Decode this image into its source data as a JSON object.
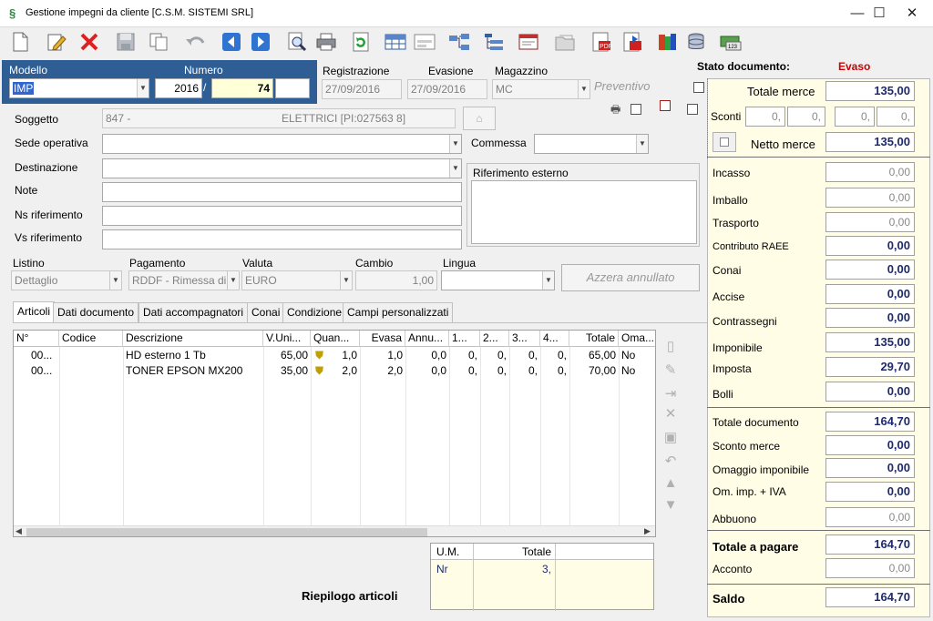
{
  "window": {
    "title": "Gestione impegni da cliente [C.S.M. SISTEMI SRL]",
    "minimize": "—",
    "maximize": "☐",
    "close": "✕"
  },
  "toolbar": {
    "icons": [
      "new-document-icon",
      "edit-icon",
      "delete-icon",
      "save-icon",
      "copy-icon",
      "undo-icon",
      "previous-record-icon",
      "next-record-icon",
      "search-icon",
      "print-icon",
      "refresh-icon",
      "table-icon",
      "form-view-icon",
      "transfer-icon",
      "tree-list-icon",
      "email-icon",
      "folder-icon",
      "pdf-icon",
      "pdf-send-icon",
      "books-icon",
      "database-icon",
      "money-icon"
    ]
  },
  "header": {
    "modello_label": "Modello",
    "modello_value": "IMP",
    "numero_label": "Numero",
    "numero_year": "2016",
    "numero_sep": "/",
    "numero_value": "74",
    "registrazione_label": "Registrazione",
    "registrazione_value": "27/09/2016",
    "evasione_label": "Evasione",
    "evasione_value": "27/09/2016",
    "magazzino_label": "Magazzino",
    "magazzino_value": "MC",
    "preventivo_label": "Preventivo"
  },
  "form": {
    "soggetto_label": "Soggetto",
    "soggetto_code": "847 -",
    "soggetto_name": "ELETTRICI [PI:027563       8]",
    "sede_label": "Sede operativa",
    "commessa_label": "Commessa",
    "destinazione_label": "Destinazione",
    "note_label": "Note",
    "riferimento_esterno_label": "Riferimento esterno",
    "ns_rif_label": "Ns riferimento",
    "vs_rif_label": "Vs riferimento"
  },
  "row2": {
    "listino_label": "Listino",
    "listino_value": "Dettaglio",
    "pagamento_label": "Pagamento",
    "pagamento_value": "RDDF - Rimessa dir",
    "valuta_label": "Valuta",
    "valuta_value": "EURO",
    "cambio_label": "Cambio",
    "cambio_value": "1,00",
    "lingua_label": "Lingua",
    "azzera_label": "Azzera annullato"
  },
  "tabs": [
    "Articoli",
    "Dati documento",
    "Dati accompagnatori",
    "Conai",
    "Condizione",
    "Campi personalizzati"
  ],
  "grid": {
    "columns": [
      "N°",
      "Codice",
      "Descrizione",
      "V.Uni...",
      "Quan...",
      "Evasa",
      "Annu...",
      "1...",
      "2...",
      "3...",
      "4...",
      "Totale",
      "Oma..."
    ],
    "rows": [
      [
        "00...",
        "",
        "HD esterno 1 Tb",
        "65,00",
        "1,0",
        "1,0",
        "0,0",
        "0,",
        "0,",
        "0,",
        "0,",
        "65,00",
        "No"
      ],
      [
        "00...",
        "",
        "TONER EPSON MX200",
        "35,00",
        "2,0",
        "2,0",
        "0,0",
        "0,",
        "0,",
        "0,",
        "0,",
        "70,00",
        "No"
      ]
    ]
  },
  "summary": {
    "title": "Riepilogo articoli",
    "um_label": "U.M.",
    "totale_label": "Totale",
    "um_value": "Nr",
    "totale_value": "3,"
  },
  "stato": {
    "label": "Stato documento:",
    "value": "Evaso",
    "value_color": "#d00000"
  },
  "totals": {
    "totale_merce_label": "Totale merce",
    "totale_merce": "135,00",
    "sconti_label": "Sconti",
    "sconti": [
      "0,",
      "0,",
      "0,",
      "0,"
    ],
    "netto_merce_label": "Netto merce",
    "netto_merce": "135,00",
    "incasso_label": "Incasso",
    "incasso": "0,00",
    "imballo_label": "Imballo",
    "imballo": "0,00",
    "trasporto_label": "Trasporto",
    "trasporto": "0,00",
    "contributo_label": "Contributo RAEE",
    "contributo": "0,00",
    "conai_label": "Conai",
    "conai": "0,00",
    "accise_label": "Accise",
    "accise": "0,00",
    "contrassegni_label": "Contrassegni",
    "contrassegni": "0,00",
    "imponibile_label": "Imponibile",
    "imponibile": "135,00",
    "imposta_label": "Imposta",
    "imposta": "29,70",
    "bolli_label": "Bolli",
    "bolli": "0,00",
    "totale_documento_label": "Totale documento",
    "totale_documento": "164,70",
    "sconto_merce_label": "Sconto merce",
    "sconto_merce": "0,00",
    "omaggio_imp_label": "Omaggio imponibile",
    "omaggio_imp": "0,00",
    "om_iva_label": "Om. imp. + IVA",
    "om_iva": "0,00",
    "abbuono_label": "Abbuono",
    "abbuono": "0,00",
    "totale_pagare_label": "Totale a pagare",
    "totale_pagare": "164,70",
    "acconto_label": "Acconto",
    "acconto": "0,00",
    "saldo_label": "Saldo",
    "saldo": "164,70"
  }
}
